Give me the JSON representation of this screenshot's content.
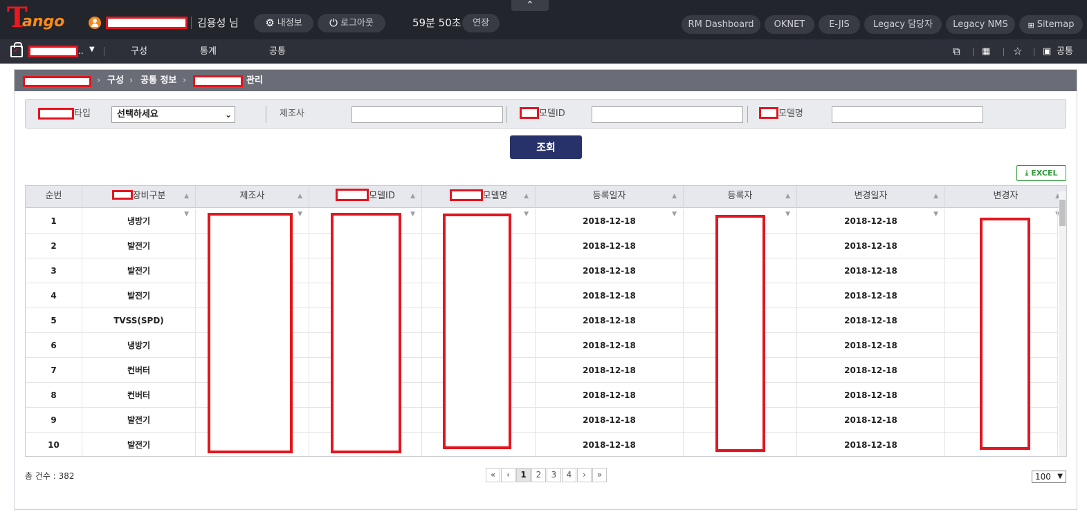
{
  "header": {
    "user_name": "김용성 님",
    "my_info_label": "내정보",
    "logout_label": "로그아웃",
    "timer": "59분 50초",
    "extend_label": "연장",
    "quick_links": [
      "RM Dashboard",
      "OKNET",
      "E-JIS",
      "Legacy 담당자",
      "Legacy NMS",
      "Sitemap"
    ],
    "logo_initial": "T",
    "logo_text": "ango"
  },
  "nav": {
    "ellipsis": "..",
    "menu": [
      "구성",
      "통계",
      "공통"
    ],
    "right_common": "공통"
  },
  "breadcrumb": {
    "items": [
      "구성",
      "공통 정보"
    ],
    "last_suffix": "관리"
  },
  "search": {
    "type_label": "타입",
    "type_value": "선택하세요",
    "maker_label": "제조사",
    "model_id_label": "모델ID",
    "model_name_label": "모델명",
    "search_button": "조회",
    "excel_button": "EXCEL"
  },
  "grid": {
    "headers": [
      "순번",
      "장비구분",
      "제조사",
      "모델ID",
      "모델명",
      "등록일자",
      "등록자",
      "변경일자",
      "변경자"
    ],
    "rows": [
      {
        "no": "1",
        "type": "냉방기",
        "reg_date": "2018-12-18",
        "mod_date": "2018-12-18"
      },
      {
        "no": "2",
        "type": "발전기",
        "reg_date": "2018-12-18",
        "mod_date": "2018-12-18"
      },
      {
        "no": "3",
        "type": "발전기",
        "reg_date": "2018-12-18",
        "mod_date": "2018-12-18"
      },
      {
        "no": "4",
        "type": "발전기",
        "reg_date": "2018-12-18",
        "mod_date": "2018-12-18"
      },
      {
        "no": "5",
        "type": "TVSS(SPD)",
        "reg_date": "2018-12-18",
        "mod_date": "2018-12-18"
      },
      {
        "no": "6",
        "type": "냉방기",
        "reg_date": "2018-12-18",
        "mod_date": "2018-12-18"
      },
      {
        "no": "7",
        "type": "컨버터",
        "reg_date": "2018-12-18",
        "mod_date": "2018-12-18"
      },
      {
        "no": "8",
        "type": "컨버터",
        "reg_date": "2018-12-18",
        "mod_date": "2018-12-18"
      },
      {
        "no": "9",
        "type": "발전기",
        "reg_date": "2018-12-18",
        "mod_date": "2018-12-18"
      },
      {
        "no": "10",
        "type": "발전기",
        "reg_date": "2018-12-18",
        "mod_date": "2018-12-18"
      }
    ]
  },
  "footer": {
    "total_label": "총 건수 : 382",
    "pages": [
      "1",
      "2",
      "3",
      "4"
    ],
    "current_page": "1",
    "page_size": "100"
  },
  "colors": {
    "redaction": "#e3151e",
    "header_bg": "#23252d",
    "search_button": "#27326a",
    "excel": "#2e9b3a"
  }
}
